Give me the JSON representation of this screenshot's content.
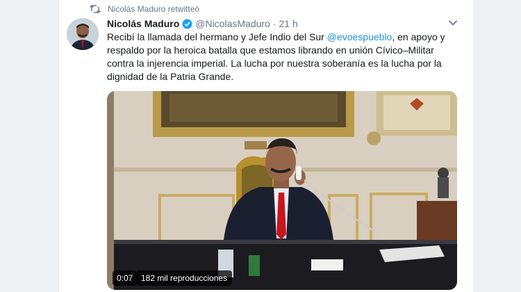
{
  "retweet": {
    "icon": "retweet-icon",
    "text": "Nicolás Maduro retwitteó"
  },
  "tweet": {
    "author_name": "Nicolás Maduro",
    "handle": "@NicolasMaduro",
    "separator": "·",
    "time": "21 h",
    "verified_icon": "verified-badge-icon",
    "menu_icon": "chevron-down-icon",
    "text_lines": [
      {
        "before": "Recibí la llamada del hermano y Jefe Indio del Sur ",
        "mention": "@evoespueblo",
        "after": ", en apoyo y"
      },
      {
        "text": "respaldo por la heroica batalla que estamos librando en unión Cívico–Militar"
      },
      {
        "text": "contra la injerencia imperial. La lucha por nuestra soberanía es la lucha por la"
      },
      {
        "text": "dignidad de la Patria Grande."
      }
    ]
  },
  "video": {
    "duration": "0:07",
    "views": "182 mil reproducciones"
  },
  "colors": {
    "link": "#1b95e0",
    "secondary_text": "#657786",
    "verified": "#1da1f2"
  }
}
